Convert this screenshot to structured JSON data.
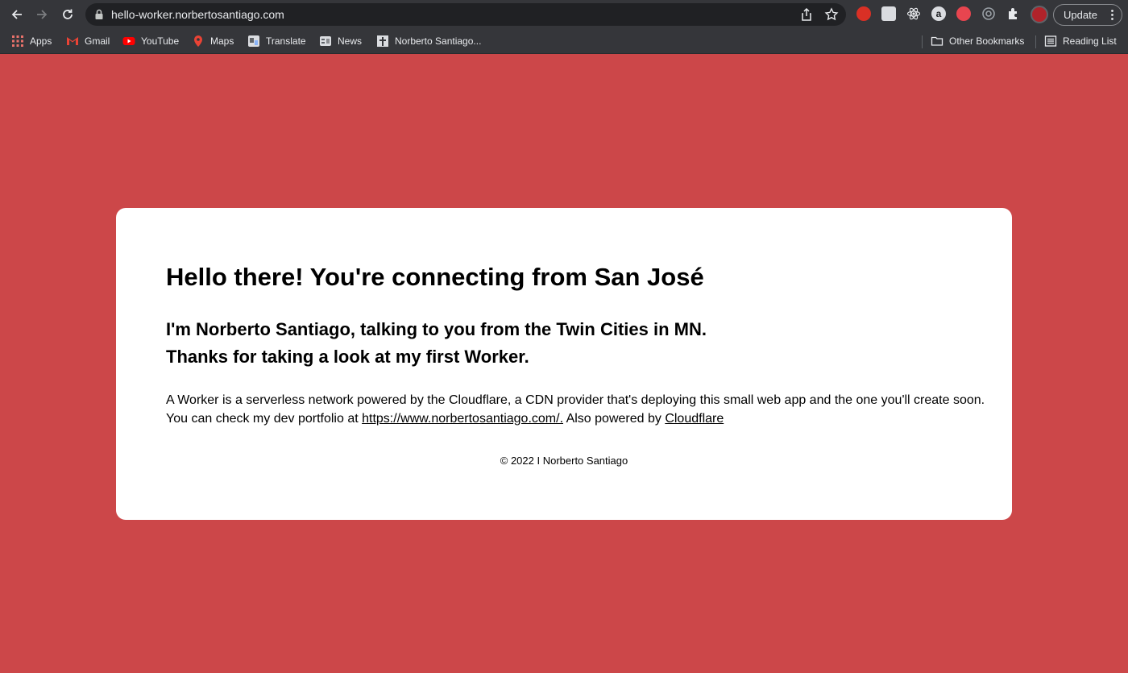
{
  "browser": {
    "url": "hello-worker.norbertosantiago.com",
    "update_label": "Update",
    "accent_color": "#8ab4f8"
  },
  "bookmarks": [
    {
      "label": "Apps",
      "icon": "apps-grid-icon"
    },
    {
      "label": "Gmail",
      "icon": "gmail-icon"
    },
    {
      "label": "YouTube",
      "icon": "youtube-icon"
    },
    {
      "label": "Maps",
      "icon": "maps-pin-icon"
    },
    {
      "label": "Translate",
      "icon": "translate-icon"
    },
    {
      "label": "News",
      "icon": "news-icon"
    },
    {
      "label": "Norberto Santiago...",
      "icon": "cross-icon"
    }
  ],
  "bookmarks_right": {
    "other": "Other Bookmarks",
    "reading": "Reading List"
  },
  "extensions": [
    "adblock-icon",
    "notion-icon",
    "react-devtools-icon",
    "amazon-icon",
    "dribbble-icon",
    "vpn-icon",
    "puzzle-extensions-icon",
    "profile-avatar"
  ],
  "page": {
    "background_color": "#cc4749",
    "heading": "Hello there! You're connecting from San José",
    "intro_line1": "I'm Norberto Santiago, talking to you from the Twin Cities in MN.",
    "intro_line2": "Thanks for taking a look at my first Worker.",
    "paragraph_line1": "A Worker is a serverless network powered by the Cloudflare, a CDN provider that's deploying this small web app and the one you'll create soon.",
    "paragraph_line2_prefix": "You can check my dev portfolio at ",
    "portfolio_link": "https://www.norbertosantiago.com/.",
    "paragraph_line2_mid": " Also powered by ",
    "cloudflare_link": "Cloudflare",
    "footer": "© 2022 I Norberto Santiago"
  }
}
